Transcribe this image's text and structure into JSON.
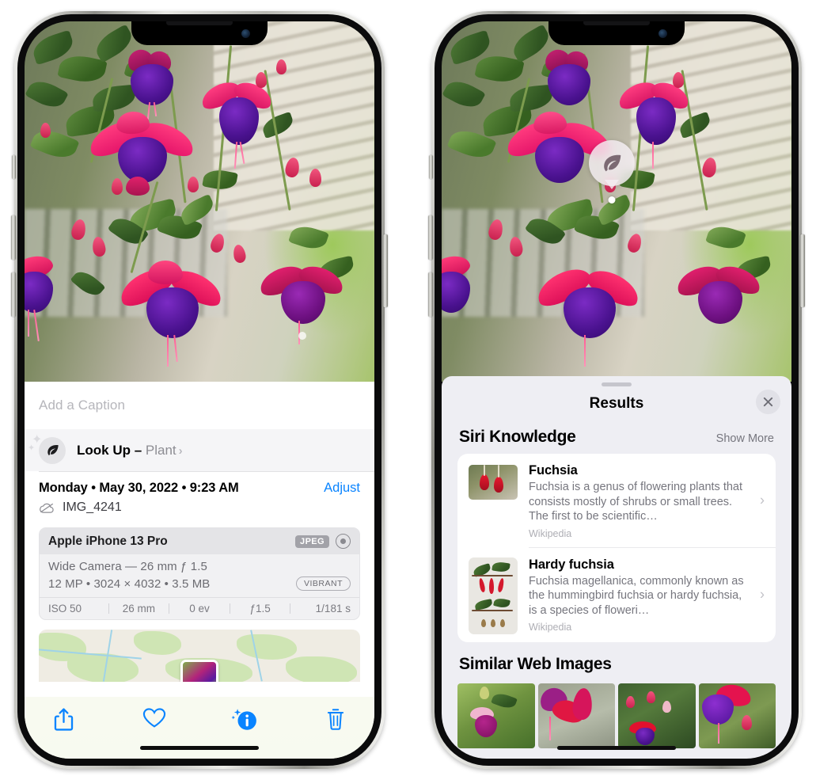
{
  "left_phone": {
    "caption_field": {
      "placeholder": "Add a Caption",
      "value": ""
    },
    "lookup_row": {
      "icon": "leaf-icon",
      "sparkle_icon": "sparkles-icon",
      "label_bold": "Look Up –",
      "label_thin": "Plant",
      "chevron": "›"
    },
    "metadata": {
      "date": "Monday • May 30, 2022 • 9:23 AM",
      "adjust_label": "Adjust",
      "cloud_icon": "icloud-slash-icon",
      "filename": "IMG_4241"
    },
    "exif": {
      "device": "Apple iPhone 13 Pro",
      "format_badge": "JPEG",
      "aperture_icon": "aperture-icon",
      "lens_line": "Wide Camera — 26 mm ƒ 1.5",
      "size_line": "12 MP • 3024 × 4032 • 3.5 MB",
      "style_badge": "VIBRANT",
      "stats": [
        "ISO 50",
        "26 mm",
        "0 ev",
        "ƒ1.5",
        "1/181 s"
      ]
    },
    "map": {
      "thumb_alt": "photo-location-thumbnail"
    },
    "toolbar": [
      {
        "name": "share-button",
        "icon": "share-icon"
      },
      {
        "name": "favorite-button",
        "icon": "heart-icon"
      },
      {
        "name": "info-button",
        "icon": "info-sparkle-icon"
      },
      {
        "name": "delete-button",
        "icon": "trash-icon"
      }
    ],
    "accent_color": "#0a84ff"
  },
  "right_phone": {
    "visual_lookup_pin": {
      "icon": "leaf-icon",
      "label": "plant-indicator"
    },
    "sheet": {
      "title": "Results",
      "close_icon": "close-icon",
      "grabber": "drag-handle"
    },
    "siri_knowledge": {
      "section_title": "Siri Knowledge",
      "action_label": "Show More",
      "items": [
        {
          "title": "Fuchsia",
          "description": "Fuchsia is a genus of flowering plants that consists mostly of shrubs or small trees. The first to be scientific…",
          "source": "Wikipedia",
          "chevron": "›"
        },
        {
          "title": "Hardy fuchsia",
          "description": "Fuchsia magellanica, commonly known as the hummingbird fuchsia or hardy fuchsia, is a species of floweri…",
          "source": "Wikipedia",
          "chevron": "›"
        }
      ]
    },
    "similar_web_images": {
      "section_title": "Similar Web Images",
      "items": [
        {
          "name": "web-image-1"
        },
        {
          "name": "web-image-2"
        },
        {
          "name": "web-image-3"
        },
        {
          "name": "web-image-4"
        }
      ]
    }
  }
}
